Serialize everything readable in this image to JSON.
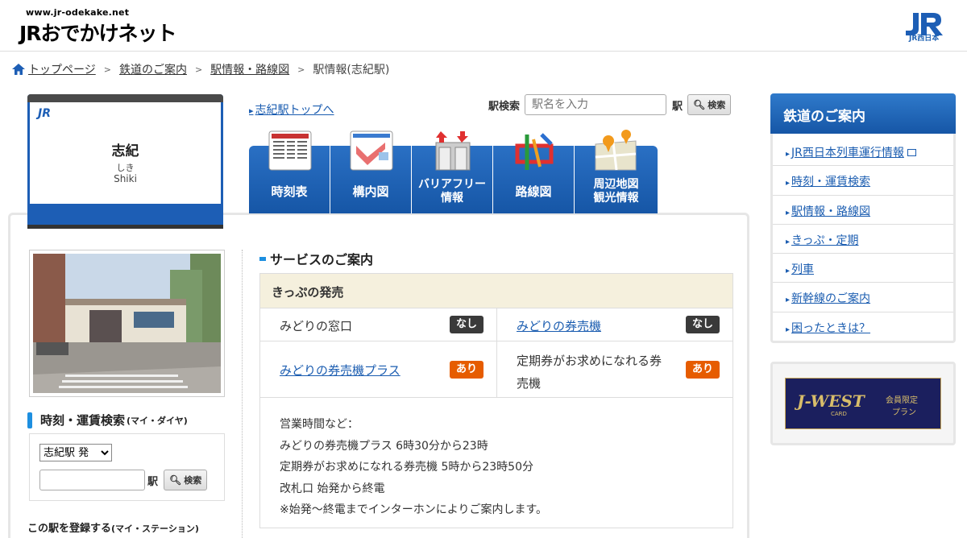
{
  "header": {
    "site_url": "www.jr-odekake.net",
    "site_logo": "JRおでかけネット",
    "brand_sub": "JR西日本",
    "brand_color": "#1d5eb5"
  },
  "breadcrumb": [
    {
      "label": "トップページ",
      "link": true
    },
    {
      "label": "鉄道のご案内",
      "link": true
    },
    {
      "label": "駅情報・路線図",
      "link": true
    },
    {
      "label": "駅情報(志紀駅)",
      "link": false
    }
  ],
  "station": {
    "badge": "JR",
    "name": "志紀",
    "kana": "しき",
    "roman": "Shiki"
  },
  "station_top_link": "志紀駅トップへ",
  "station_search": {
    "label": "駅検索",
    "placeholder": "駅名を入力",
    "suffix": "駅",
    "button": "検索"
  },
  "tabs": [
    {
      "label": "時刻表",
      "icon": "timetable-icon"
    },
    {
      "label": "構内図",
      "icon": "floor-map-icon"
    },
    {
      "label_line1": "バリアフリー",
      "label_line2": "情報",
      "icon": "barrier-free-icon"
    },
    {
      "label": "路線図",
      "icon": "route-map-icon"
    },
    {
      "label_line1": "周辺地図",
      "label_line2": "観光情報",
      "icon": "area-map-icon"
    }
  ],
  "sidebar": {
    "search_title": "時刻・運賃検索",
    "search_title_sub": "(マイ・ダイヤ)",
    "select_value": "志紀駅 発",
    "suffix": "駅",
    "button": "検索",
    "register_title": "この駅を登録する",
    "register_sub": "(マイ・ステーション)"
  },
  "services": {
    "section_title": "サービスのご案内",
    "table_head": "きっぷの発売",
    "rows": [
      [
        {
          "label": "みどりの窓口",
          "link": false,
          "status": "なし"
        },
        {
          "label": "みどりの券売機",
          "link": true,
          "status": "なし"
        }
      ],
      [
        {
          "label": "みどりの券売機プラス",
          "link": true,
          "status": "あり"
        },
        {
          "label_line1": "定期券がお求めになれる券",
          "label_line2": "売機",
          "link": false,
          "status": "あり"
        }
      ]
    ],
    "notes": [
      "営業時間など：",
      "みどりの券売機プラス 6時30分から23時",
      "定期券がお求めになれる券売機 5時から23時50分",
      "改札口 始発から終電",
      "※始発～終電までインターホンによりご案内します。"
    ],
    "colors": {
      "none": "#3a3a3a",
      "yes": "#e65c00"
    }
  },
  "right_nav": {
    "title": "鉄道のご案内",
    "items": [
      "JR西日本列車運行情報",
      "時刻・運賃検索",
      "駅情報・路線図",
      "きっぷ・定期",
      "列車",
      "新幹線のご案内",
      "困ったときは？"
    ]
  },
  "banner": {
    "main": "J-WEST",
    "card": "CARD",
    "sub1": "会員限定",
    "sub2": "プラン"
  }
}
